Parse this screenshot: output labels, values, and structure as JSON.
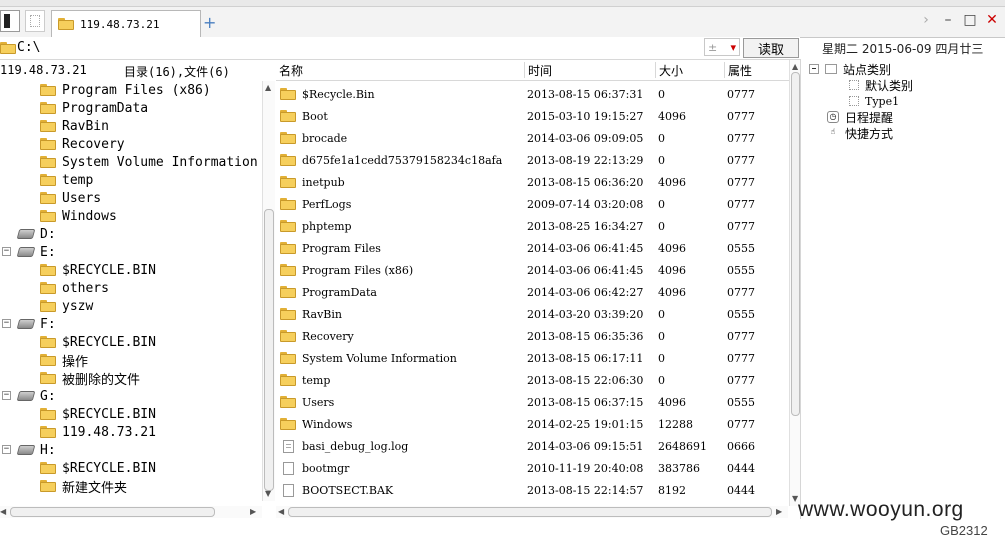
{
  "tab": {
    "title": "119.48.73.21",
    "add": "+"
  },
  "window": {
    "prev": "›",
    "min": "–",
    "max": "□",
    "close": "✕"
  },
  "address": {
    "path": "C:\\",
    "combo_value": "±",
    "combo_arrow": "▾",
    "read_button": "读取"
  },
  "datebar": {
    "text": "星期二 2015-06-09 四月廿三"
  },
  "left_panel": {
    "host": "119.48.73.21",
    "summary": "目录(16),文件(6)",
    "tree": [
      {
        "label": "Program Files (x86)",
        "level": 2,
        "icon": "folder"
      },
      {
        "label": "ProgramData",
        "level": 2,
        "icon": "folder"
      },
      {
        "label": "RavBin",
        "level": 2,
        "icon": "folder"
      },
      {
        "label": "Recovery",
        "level": 2,
        "icon": "folder"
      },
      {
        "label": "System Volume Information",
        "level": 2,
        "icon": "folder"
      },
      {
        "label": "temp",
        "level": 2,
        "icon": "folder"
      },
      {
        "label": "Users",
        "level": 2,
        "icon": "folder"
      },
      {
        "label": "Windows",
        "level": 2,
        "icon": "folder"
      },
      {
        "label": "D:",
        "level": 1,
        "icon": "drive",
        "expander": ""
      },
      {
        "label": "E:",
        "level": 1,
        "icon": "drive",
        "expander": "−"
      },
      {
        "label": "$RECYCLE.BIN",
        "level": 2,
        "icon": "folder"
      },
      {
        "label": "others",
        "level": 2,
        "icon": "folder"
      },
      {
        "label": "yszw",
        "level": 2,
        "icon": "folder"
      },
      {
        "label": "F:",
        "level": 1,
        "icon": "drive",
        "expander": "−"
      },
      {
        "label": "$RECYCLE.BIN",
        "level": 2,
        "icon": "folder"
      },
      {
        "label": "操作",
        "level": 2,
        "icon": "folder"
      },
      {
        "label": "被删除的文件",
        "level": 2,
        "icon": "folder"
      },
      {
        "label": "G:",
        "level": 1,
        "icon": "drive",
        "expander": "−"
      },
      {
        "label": "$RECYCLE.BIN",
        "level": 2,
        "icon": "folder"
      },
      {
        "label": "119.48.73.21",
        "level": 2,
        "icon": "folder"
      },
      {
        "label": "H:",
        "level": 1,
        "icon": "drive",
        "expander": "−"
      },
      {
        "label": "$RECYCLE.BIN",
        "level": 2,
        "icon": "folder"
      },
      {
        "label": "新建文件夹",
        "level": 2,
        "icon": "folder"
      }
    ]
  },
  "file_list": {
    "columns": [
      "名称",
      "时间",
      "大小",
      "属性"
    ],
    "rows": [
      {
        "name": "$Recycle.Bin",
        "time": "2013-08-15 06:37:31",
        "size": "0",
        "attr": "0777",
        "icon": "folder"
      },
      {
        "name": "Boot",
        "time": "2015-03-10 19:15:27",
        "size": "4096",
        "attr": "0777",
        "icon": "folder"
      },
      {
        "name": "brocade",
        "time": "2014-03-06 09:09:05",
        "size": "0",
        "attr": "0777",
        "icon": "folder"
      },
      {
        "name": "d675fe1a1cedd75379158234c18afa",
        "time": "2013-08-19 22:13:29",
        "size": "0",
        "attr": "0777",
        "icon": "folder"
      },
      {
        "name": "inetpub",
        "time": "2013-08-15 06:36:20",
        "size": "4096",
        "attr": "0777",
        "icon": "folder"
      },
      {
        "name": "PerfLogs",
        "time": "2009-07-14 03:20:08",
        "size": "0",
        "attr": "0777",
        "icon": "folder"
      },
      {
        "name": "phptemp",
        "time": "2013-08-25 16:34:27",
        "size": "0",
        "attr": "0777",
        "icon": "folder"
      },
      {
        "name": "Program Files",
        "time": "2014-03-06 06:41:45",
        "size": "4096",
        "attr": "0555",
        "icon": "folder"
      },
      {
        "name": "Program Files (x86)",
        "time": "2014-03-06 06:41:45",
        "size": "4096",
        "attr": "0555",
        "icon": "folder"
      },
      {
        "name": "ProgramData",
        "time": "2014-03-06 06:42:27",
        "size": "4096",
        "attr": "0777",
        "icon": "folder"
      },
      {
        "name": "RavBin",
        "time": "2014-03-20 03:39:20",
        "size": "0",
        "attr": "0555",
        "icon": "folder"
      },
      {
        "name": "Recovery",
        "time": "2013-08-15 06:35:36",
        "size": "0",
        "attr": "0777",
        "icon": "folder"
      },
      {
        "name": "System Volume Information",
        "time": "2013-08-15 06:17:11",
        "size": "0",
        "attr": "0777",
        "icon": "folder"
      },
      {
        "name": "temp",
        "time": "2013-08-15 22:06:30",
        "size": "0",
        "attr": "0777",
        "icon": "folder"
      },
      {
        "name": "Users",
        "time": "2013-08-15 06:37:15",
        "size": "4096",
        "attr": "0555",
        "icon": "folder"
      },
      {
        "name": "Windows",
        "time": "2014-02-25 19:01:15",
        "size": "12288",
        "attr": "0777",
        "icon": "folder"
      },
      {
        "name": "basi_debug_log.log",
        "time": "2014-03-06 09:15:51",
        "size": "2648691",
        "attr": "0666",
        "icon": "file-lines"
      },
      {
        "name": "bootmgr",
        "time": "2010-11-19 20:40:08",
        "size": "383786",
        "attr": "0444",
        "icon": "file"
      },
      {
        "name": "BOOTSECT.BAK",
        "time": "2013-08-15 22:14:57",
        "size": "8192",
        "attr": "0444",
        "icon": "file"
      }
    ]
  },
  "right_panel": {
    "items": [
      {
        "label": "站点类别",
        "level": 0,
        "icon": "expander-minus"
      },
      {
        "label": "默认类别",
        "level": 1,
        "icon": "box"
      },
      {
        "label": "Type1",
        "level": 1,
        "icon": "box"
      },
      {
        "label": "日程提醒",
        "level": 0,
        "icon": "clock"
      },
      {
        "label": "快捷方式",
        "level": 0,
        "icon": "hand"
      }
    ]
  },
  "watermark": {
    "site": "www.wooyun.org",
    "code": "GB2312"
  }
}
